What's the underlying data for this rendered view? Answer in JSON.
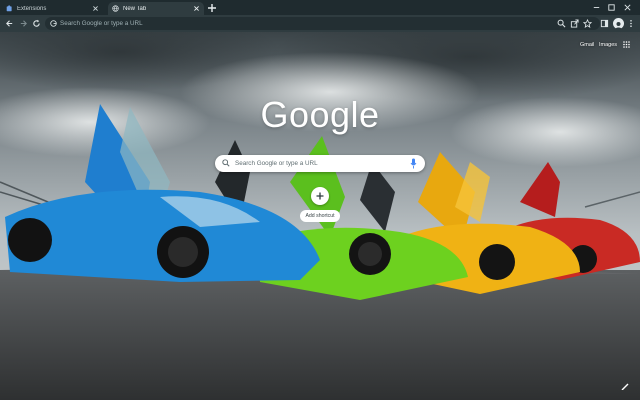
{
  "tabs": [
    {
      "label": "Extensions",
      "icon": "puzzle-icon"
    },
    {
      "label": "New Tab",
      "icon": "globe-icon"
    }
  ],
  "omnibox": {
    "placeholder": "Search Google or type a URL"
  },
  "ntp": {
    "gmail_label": "Gmail",
    "images_label": "Images",
    "logo_text": "Google",
    "search_placeholder": "Search Google or type a URL",
    "add_shortcut_label": "Add shortcut"
  },
  "theme": {
    "frame_color": "#1f2b2f",
    "toolbar_color": "#2f3c40",
    "omnibox_color": "#232f33"
  },
  "icons": [
    "back-icon",
    "forward-icon",
    "reload-icon",
    "zoom-icon",
    "share-icon",
    "bookmark-star-icon",
    "side-panel-icon",
    "profile-avatar",
    "menu-icon",
    "apps-grid-icon",
    "mic-icon",
    "customize-pencil-icon"
  ]
}
